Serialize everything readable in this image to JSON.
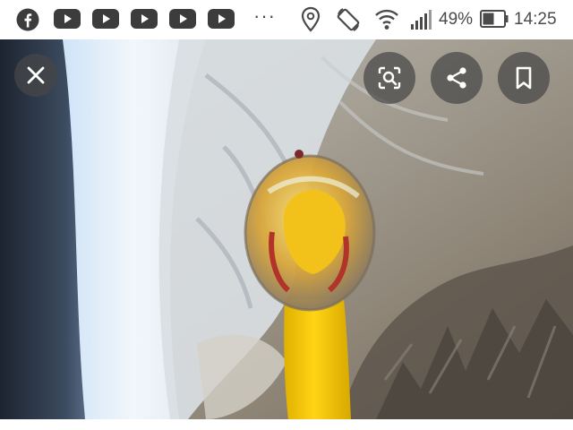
{
  "status_bar": {
    "notification_icons": [
      "facebook-icon",
      "youtube-icon",
      "youtube-icon",
      "youtube-icon",
      "youtube-icon",
      "youtube-icon"
    ],
    "more_label": "···",
    "system_icons": [
      "location-icon",
      "auto-rotate-icon",
      "wifi-icon",
      "signal-icon"
    ],
    "battery": "49%",
    "time": "14:25"
  },
  "viewer": {
    "buttons": [
      "close-icon",
      "lens-search-icon",
      "share-icon",
      "bookmark-icon"
    ]
  },
  "colors": {
    "overlay_button": "#464646",
    "status_text": "#4a4a4a",
    "youtube_icon": "#3c3c3c",
    "rubber_chicken": "#f2c400"
  }
}
